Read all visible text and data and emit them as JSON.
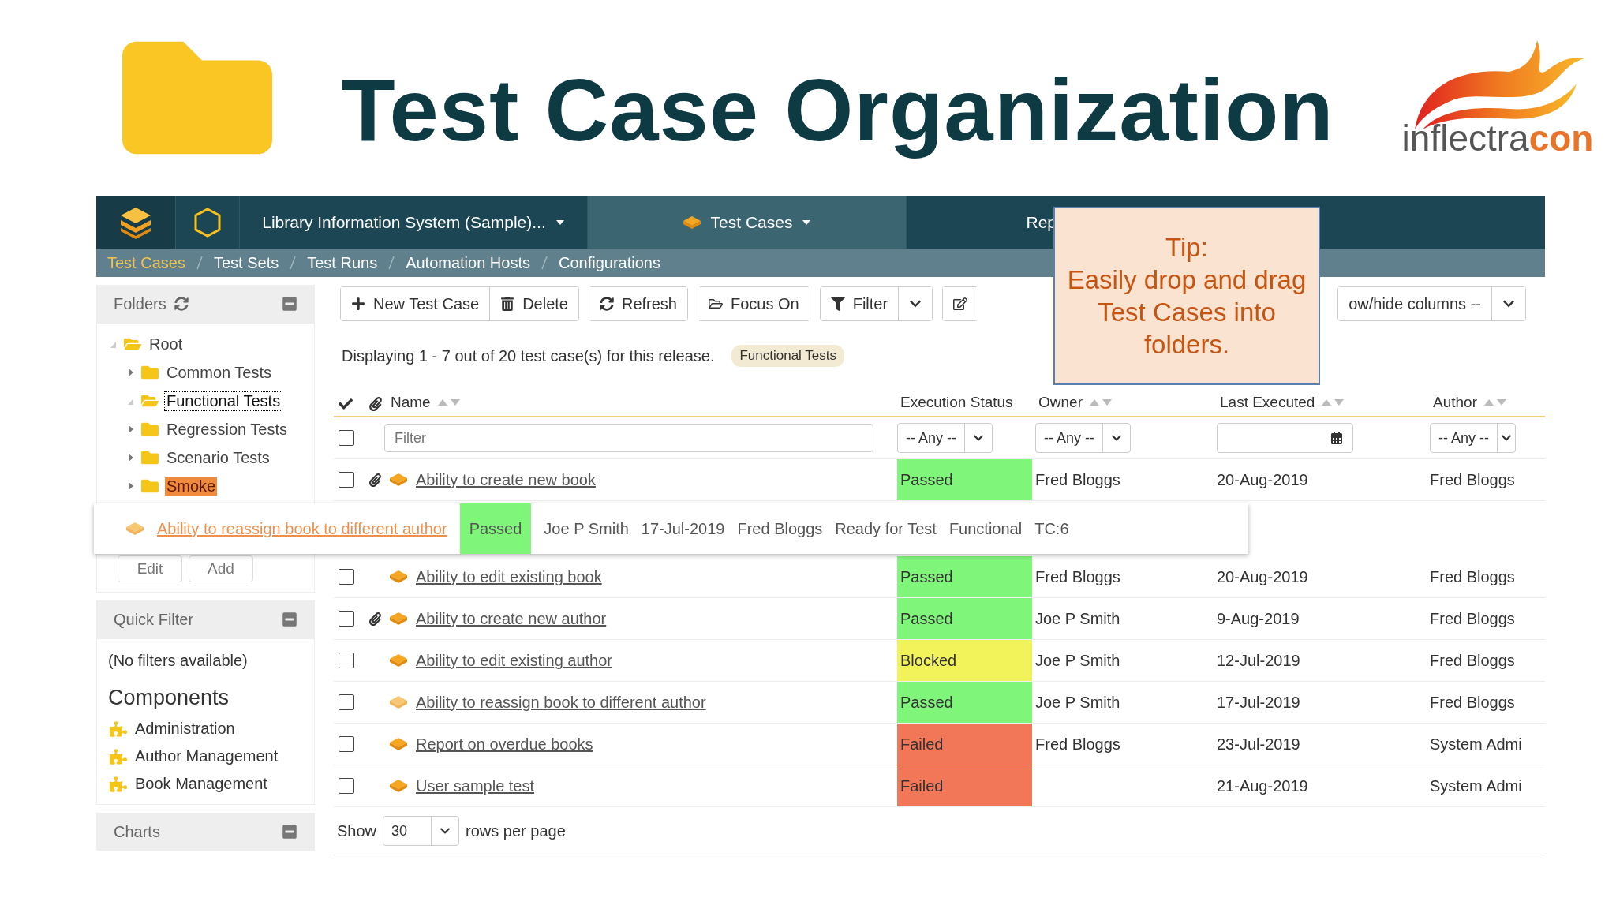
{
  "slide": {
    "title": "Test Case Organization"
  },
  "logo": {
    "word": "inflectra",
    "accent": "con"
  },
  "nav": {
    "project": "Library Information System (Sample)...",
    "artifact": "Test Cases",
    "next": "Rep"
  },
  "breadcrumbs": [
    {
      "label": "Test Cases",
      "selected": true
    },
    {
      "label": "Test Sets",
      "selected": false
    },
    {
      "label": "Test Runs",
      "selected": false
    },
    {
      "label": "Automation Hosts",
      "selected": false
    },
    {
      "label": "Configurations",
      "selected": false
    }
  ],
  "folders": {
    "title": "Folders",
    "tree": [
      {
        "label": "Root",
        "expanded": true,
        "selected": false,
        "drop_target": false,
        "children": [
          {
            "label": "Common Tests",
            "expanded": false,
            "selected": false,
            "drop_target": false
          },
          {
            "label": "Functional Tests",
            "expanded": true,
            "selected": true,
            "drop_target": false
          },
          {
            "label": "Regression Tests",
            "expanded": false,
            "selected": false,
            "drop_target": false
          },
          {
            "label": "Scenario Tests",
            "expanded": false,
            "selected": false,
            "drop_target": false
          },
          {
            "label": "Smoke",
            "expanded": false,
            "selected": false,
            "drop_target": true
          }
        ]
      }
    ],
    "buttons": [
      "Edit",
      "Add"
    ]
  },
  "quick_filter": {
    "title": "Quick Filter",
    "message": "(No filters available)"
  },
  "components": {
    "title": "Components",
    "items": [
      "Administration",
      "Author Management",
      "Book Management"
    ]
  },
  "charts": {
    "title": "Charts"
  },
  "toolbar": {
    "buttons": [
      "New Test Case",
      "Delete",
      "Refresh",
      "Focus On",
      "Filter"
    ],
    "columns_select": "ow/hide columns --"
  },
  "summary": {
    "text": "Displaying 1 - 7 out of 20 test case(s) for this release.",
    "folder_tag": "Functional Tests"
  },
  "columns": [
    {
      "label": "Name",
      "sortable": true
    },
    {
      "label": "Execution Status",
      "sortable": false
    },
    {
      "label": "Owner",
      "sortable": true
    },
    {
      "label": "Last Executed",
      "sortable": true
    },
    {
      "label": "Author",
      "sortable": true
    }
  ],
  "filters": {
    "select_all_checked": false,
    "name_placeholder": "Filter",
    "status": "-- Any --",
    "owner": "-- Any --",
    "author": "-- Any --"
  },
  "rows": [
    {
      "checked": false,
      "attachment": true,
      "name": "Ability to create new book",
      "status": {
        "label": "Passed",
        "color": "#7ff57a"
      },
      "owner": "Fred Bloggs",
      "last_executed": "20-Aug-2019",
      "author": "Fred Bloggs"
    },
    {
      "checked": false,
      "attachment": false,
      "name": "Ability to edit existing book",
      "status": {
        "label": "Passed",
        "color": "#7ff57a"
      },
      "owner": "Fred Bloggs",
      "last_executed": "20-Aug-2019",
      "author": "Fred Bloggs"
    },
    {
      "checked": false,
      "attachment": true,
      "name": "Ability to create new author",
      "status": {
        "label": "Passed",
        "color": "#7ff57a"
      },
      "owner": "Joe P Smith",
      "last_executed": "9-Aug-2019",
      "author": "Fred Bloggs"
    },
    {
      "checked": false,
      "attachment": false,
      "name": "Ability to edit existing author",
      "status": {
        "label": "Blocked",
        "color": "#f2f25a"
      },
      "owner": "Joe P Smith",
      "last_executed": "12-Jul-2019",
      "author": "Fred Bloggs"
    },
    {
      "checked": false,
      "attachment": false,
      "name": "Ability to reassign book to different author",
      "status": {
        "label": "Passed",
        "color": "#7ff57a"
      },
      "owner": "Joe P Smith",
      "last_executed": "17-Jul-2019",
      "author": "Fred Bloggs"
    },
    {
      "checked": false,
      "attachment": false,
      "name": "Report on overdue books",
      "status": {
        "label": "Failed",
        "color": "#f27658"
      },
      "owner": "Fred Bloggs",
      "last_executed": "23-Jul-2019",
      "author": "System Admi"
    },
    {
      "checked": false,
      "attachment": false,
      "name": "User sample test",
      "status": {
        "label": "Failed",
        "color": "#f27658"
      },
      "last_executed": "21-Aug-2019",
      "author": "System Admi"
    }
  ],
  "pagination": {
    "label": "Show",
    "page_size": "30",
    "suffix": "rows per page"
  },
  "drag_ghost": {
    "name": "Ability to reassign book to different author",
    "status": {
      "label": "Passed",
      "color": "#7ff57a"
    },
    "owner": "Joe P Smith",
    "last_executed": "17-Jul-2019",
    "author": "Fred Bloggs",
    "state": "Ready for Test",
    "type": "Functional",
    "id": "TC:6"
  },
  "tip": {
    "title": "Tip:",
    "text": "Easily drop and drag Test Cases into folders."
  }
}
